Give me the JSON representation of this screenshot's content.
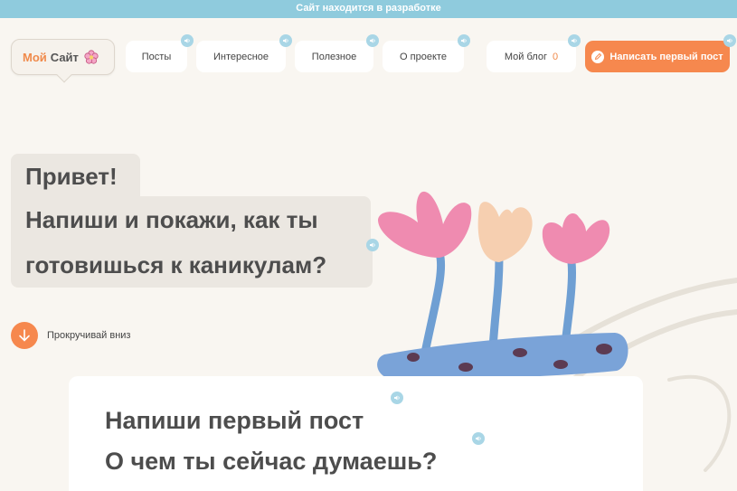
{
  "banner": {
    "text": "Сайт находится в разработке"
  },
  "logo": {
    "part1": "Мой",
    "part2": "Сайт"
  },
  "nav": {
    "items": [
      {
        "label": "Посты"
      },
      {
        "label": "Интересное"
      },
      {
        "label": "Полезное"
      },
      {
        "label": "О проекте"
      }
    ],
    "blog": {
      "label": "Мой блог",
      "count": "0"
    },
    "cta": {
      "label": "Написать первый пост"
    }
  },
  "hero": {
    "line1": "Привет!",
    "line2": "Напиши и покажи, как ты",
    "line3": "готовишься к каникулам?"
  },
  "scroll": {
    "label": "Прокручивай вниз"
  },
  "card": {
    "title": "Напиши первый пост",
    "subtitle": "О чем ты сейчас думаешь?"
  },
  "icons": {
    "speaker": "speaker-icon",
    "flower": "flower-icon",
    "pencil": "pencil-icon",
    "arrow": "arrow-down-icon"
  },
  "colors": {
    "accent": "#f6884e",
    "banner": "#8fcbdd",
    "background": "#f9f6f1",
    "speaker": "#a9d6e6"
  }
}
